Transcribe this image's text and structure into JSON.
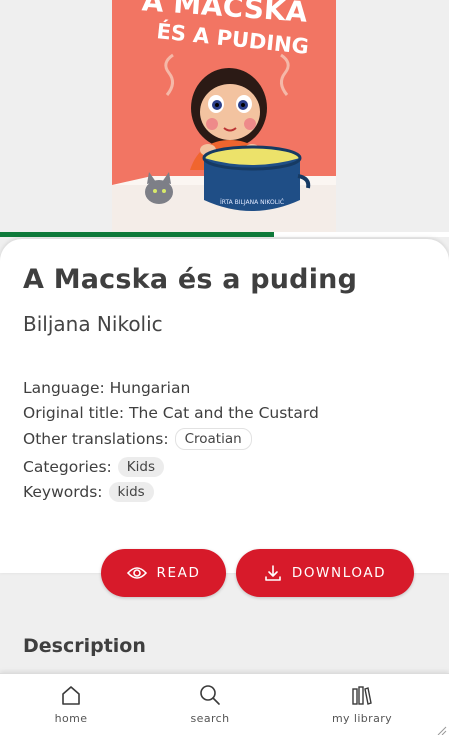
{
  "cover": {
    "title_line1": "A MACSKA",
    "title_line2": "ÉS A PUDING",
    "pot_text": "ÍRTA BILJANA NIKOLIĆ"
  },
  "reading_progress": 0.61,
  "book": {
    "title": "A Macska és a puding",
    "author": "Biljana Nikolic",
    "language_label": "Language:",
    "language": "Hungarian",
    "original_title_label": "Original title:",
    "original_title": "The Cat and the Custard",
    "translations_label": "Other translations:",
    "translations": [
      "Croatian"
    ],
    "categories_label": "Categories:",
    "categories": [
      "Kids"
    ],
    "keywords_label": "Keywords:",
    "keywords": [
      "kids"
    ]
  },
  "actions": {
    "read_label": "READ",
    "download_label": "DOWNLOAD"
  },
  "description": {
    "heading": "Description"
  },
  "nav": {
    "items": [
      {
        "label": "home",
        "icon": "home-icon"
      },
      {
        "label": "search",
        "icon": "search-icon"
      },
      {
        "label": "my library",
        "icon": "library-icon"
      }
    ]
  },
  "colors": {
    "accent": "#d71a2a",
    "progress": "#0e7a3a"
  }
}
